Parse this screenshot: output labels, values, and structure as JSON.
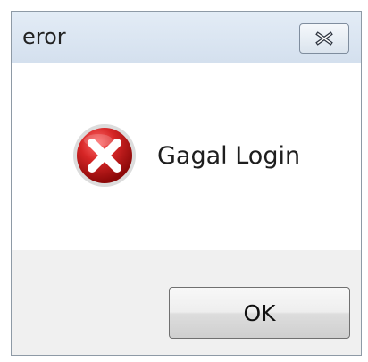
{
  "window": {
    "title": "eror"
  },
  "dialog": {
    "message": "Gagal Login",
    "ok_label": "OK"
  },
  "icons": {
    "error": "error-icon",
    "close": "close-icon"
  },
  "colors": {
    "title_bar": "#dbe6f2",
    "error_red": "#c71f1f",
    "footer": "#f0f0f0"
  }
}
